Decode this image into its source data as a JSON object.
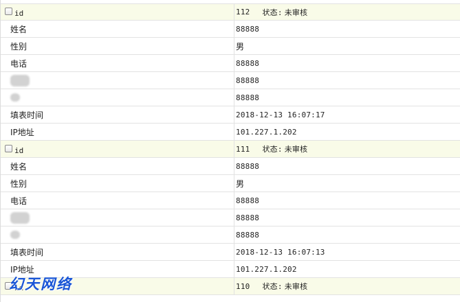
{
  "records": [
    {
      "id_label": "id",
      "id_value": "112",
      "status_label": "状态:",
      "status_value": "未审核",
      "fields": [
        {
          "label": "姓名",
          "value": "88888",
          "redacted": false
        },
        {
          "label": "性别",
          "value": "男",
          "redacted": false
        },
        {
          "label": "电话",
          "value": "88888",
          "redacted": false
        },
        {
          "label": "",
          "value": "88888",
          "redacted": true,
          "redact_size": "wide"
        },
        {
          "label": "",
          "value": "88888",
          "redacted": true,
          "redact_size": "small"
        },
        {
          "label": "填表时间",
          "value": "2018-12-13 16:07:17",
          "redacted": false
        },
        {
          "label": "IP地址",
          "value": "101.227.1.202",
          "redacted": false
        }
      ]
    },
    {
      "id_label": "id",
      "id_value": "111",
      "status_label": "状态:",
      "status_value": "未审核",
      "fields": [
        {
          "label": "姓名",
          "value": "88888",
          "redacted": false
        },
        {
          "label": "性别",
          "value": "男",
          "redacted": false
        },
        {
          "label": "电话",
          "value": "88888",
          "redacted": false
        },
        {
          "label": "",
          "value": "88888",
          "redacted": true,
          "redact_size": "wide"
        },
        {
          "label": "",
          "value": "88888",
          "redacted": true,
          "redact_size": "small"
        },
        {
          "label": "填表时间",
          "value": "2018-12-13 16:07:13",
          "redacted": false
        },
        {
          "label": "IP地址",
          "value": "101.227.1.202",
          "redacted": false
        }
      ]
    },
    {
      "id_label": "id",
      "id_value": "110",
      "status_label": "状态:",
      "status_value": "未审核",
      "fields": []
    }
  ],
  "watermark": "幻天网络",
  "colors": {
    "header_bg": "#f9fbe8",
    "border": "#e2e2e2",
    "watermark": "#1a56d6"
  }
}
